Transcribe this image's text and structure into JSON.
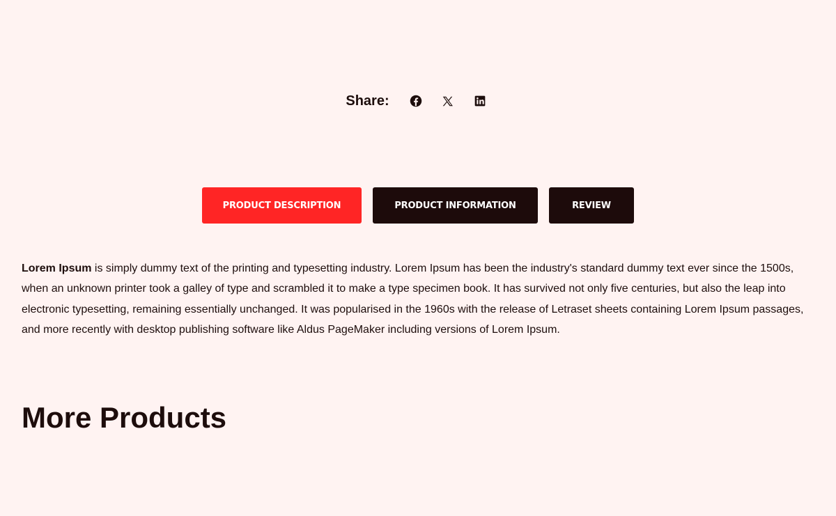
{
  "share": {
    "label": "Share:",
    "icons": [
      {
        "name": "facebook-icon"
      },
      {
        "name": "x-icon"
      },
      {
        "name": "linkedin-icon"
      }
    ]
  },
  "tabs": [
    {
      "label": "PRODUCT DESCRIPTION",
      "active": true
    },
    {
      "label": "PRODUCT INFORMATION",
      "active": false
    },
    {
      "label": "REVIEW",
      "active": false
    }
  ],
  "description": {
    "lead": "Lorem Ipsum",
    "body": " is simply dummy text of the printing and typesetting industry. Lorem Ipsum has been the industry's standard dummy text ever since the 1500s, when an unknown printer took a galley of type and scrambled it to make a type specimen book. It has survived not only five centuries, but also the leap into electronic typesetting, remaining essentially unchanged. It was popularised in the 1960s with the release of Letraset sheets containing Lorem Ipsum passages, and more recently with desktop publishing software like Aldus PageMaker including versions of Lorem Ipsum."
  },
  "more_products": {
    "title": "More Products"
  },
  "colors": {
    "background": "#fff3f2",
    "text": "#1d0d0c",
    "accent": "#ff2525",
    "tab_dark": "#1d0b0b"
  }
}
